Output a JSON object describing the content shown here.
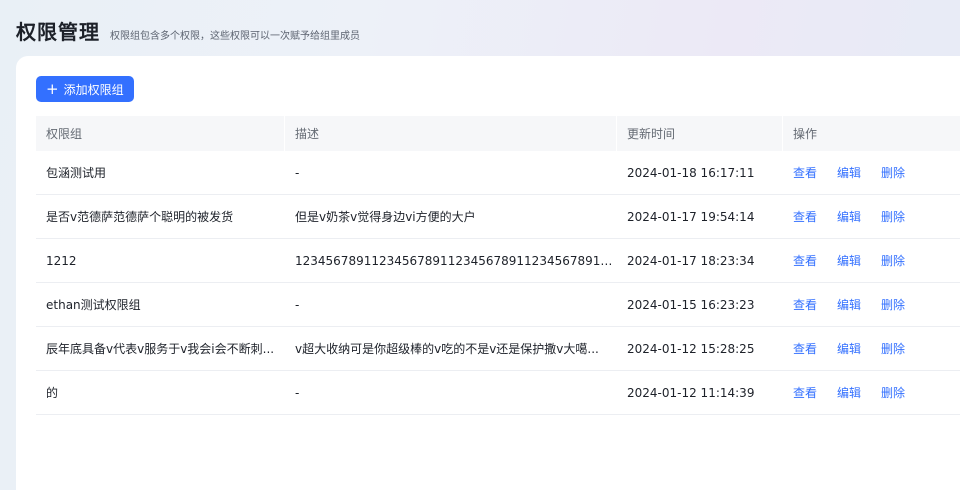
{
  "header": {
    "title": "权限管理",
    "subtitle": "权限组包含多个权限，这些权限可以一次赋予给组里成员"
  },
  "toolbar": {
    "add_label": "添加权限组",
    "add_icon": "plus-icon"
  },
  "colors": {
    "primary": "#3370ff",
    "header_bg": "#f6f7f9"
  },
  "table": {
    "columns": [
      "权限组",
      "描述",
      "更新时间",
      "操作"
    ],
    "actions": [
      "查看",
      "编辑",
      "删除"
    ],
    "rows": [
      {
        "name": "包涵测试用",
        "desc": "-",
        "time": "2024-01-18 16:17:11"
      },
      {
        "name": "是否v范德萨范德萨个聪明的被发货",
        "desc": "但是v奶茶v觉得身边vi方便的大户",
        "time": "2024-01-17 19:54:14"
      },
      {
        "name": "1212",
        "desc": "12345678911234567891123456789112345678911234567891123...",
        "time": "2024-01-17 18:23:34"
      },
      {
        "name": "ethan测试权限组",
        "desc": "-",
        "time": "2024-01-15 16:23:23"
      },
      {
        "name": "辰年底具备v代表v服务于v我会i会不断刺...",
        "desc": "v超大收纳可是你超级棒的v吃的不是v还是保护撒v大噶...",
        "time": "2024-01-12 15:28:25"
      },
      {
        "name": "的",
        "desc": "-",
        "time": "2024-01-12 11:14:39"
      }
    ]
  }
}
